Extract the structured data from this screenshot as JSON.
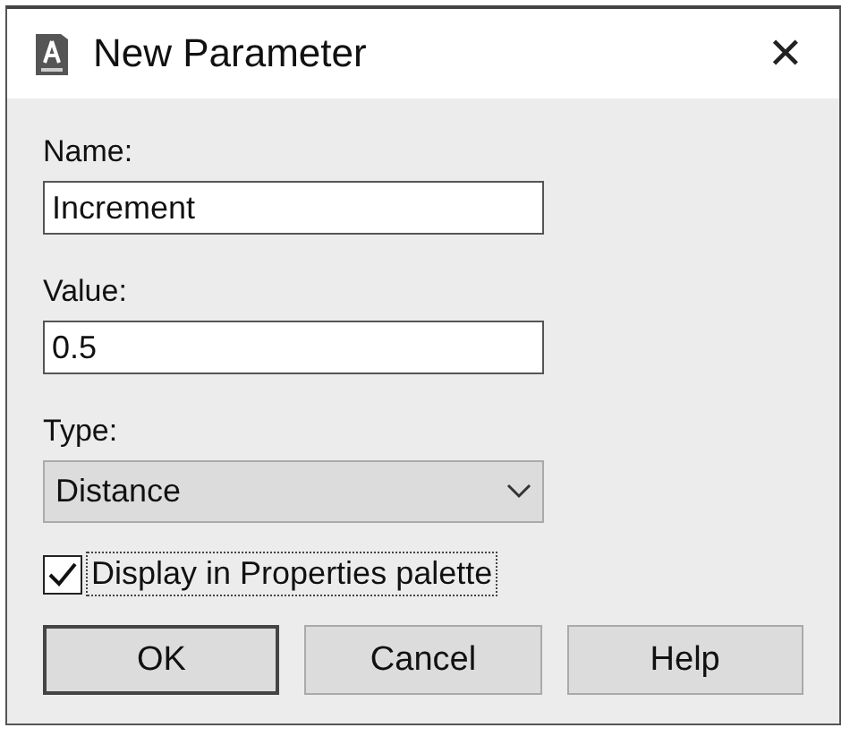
{
  "window": {
    "title": "New Parameter",
    "close": "✕"
  },
  "fields": [
    {
      "label": "Name:",
      "value": "Increment"
    },
    {
      "label": "Value:",
      "value": "0.5"
    }
  ],
  "type": {
    "label": "Type:",
    "value": "Distance"
  },
  "checkbox": {
    "label": "Display in Properties palette",
    "checked": true
  },
  "buttons": [
    {
      "label": "OK",
      "default": true
    },
    {
      "label": "Cancel",
      "default": false
    },
    {
      "label": "Help",
      "default": false
    }
  ]
}
